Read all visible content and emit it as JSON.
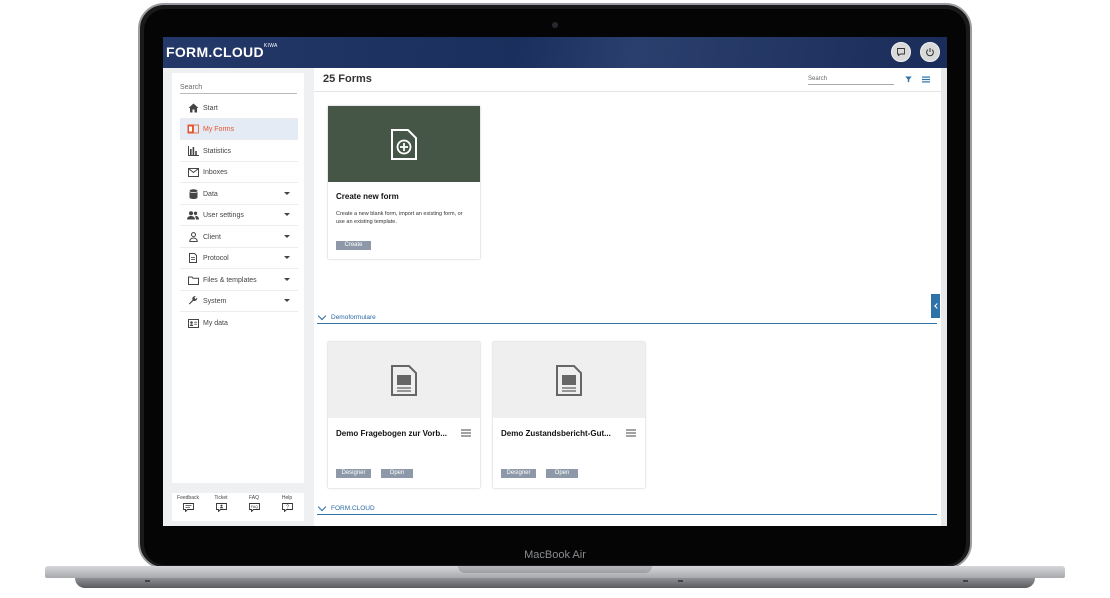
{
  "device": {
    "brand": "MacBook Air"
  },
  "app": {
    "logo": "FORM.CLOUD",
    "logo_sup": "KIWA"
  },
  "header": {
    "buttons": [
      {
        "icon": "chat-icon"
      },
      {
        "icon": "power-icon"
      }
    ]
  },
  "sidebar": {
    "search_placeholder": "Search",
    "items": [
      {
        "label": "Start",
        "icon": "home-icon"
      },
      {
        "label": "My Forms",
        "icon": "forms-icon",
        "active": true
      },
      {
        "label": "Statistics",
        "icon": "bar-chart-icon"
      },
      {
        "label": "Inboxes",
        "icon": "mail-icon"
      },
      {
        "label": "Data",
        "icon": "database-icon",
        "expandable": true
      },
      {
        "label": "User settings",
        "icon": "users-icon",
        "expandable": true
      },
      {
        "label": "Client",
        "icon": "person-icon",
        "expandable": true
      },
      {
        "label": "Protocol",
        "icon": "document-icon",
        "expandable": true
      },
      {
        "label": "Files & templates",
        "icon": "folder-icon",
        "expandable": true
      },
      {
        "label": "System",
        "icon": "wrench-icon",
        "expandable": true
      },
      {
        "label": "My data",
        "icon": "id-card-icon"
      }
    ]
  },
  "footer": {
    "items": [
      {
        "label": "Feedback",
        "icon": "feedback-icon"
      },
      {
        "label": "Ticket",
        "icon": "ticket-icon"
      },
      {
        "label": "FAQ",
        "icon": "faq-icon"
      },
      {
        "label": "Help",
        "icon": "help-icon"
      }
    ]
  },
  "content": {
    "title": "25 Forms",
    "search_placeholder": "Search",
    "create_card": {
      "title": "Create new form",
      "description": "Create a new blank form, import an existing form, or use an existing template.",
      "button": "Create",
      "image_color": "#465646"
    },
    "sections": [
      {
        "name": "Demoformulare",
        "cards": [
          {
            "title": "Demo Fragebogen zur Vorb...",
            "buttons": [
              "Designer",
              "Open"
            ]
          },
          {
            "title": "Demo Zustandsbericht-Gut...",
            "buttons": [
              "Designer",
              "Open"
            ]
          }
        ]
      },
      {
        "name": "FORM.CLOUD"
      }
    ]
  },
  "colors": {
    "header": "#1f335f",
    "accent": "#2f72a8",
    "active_text": "#e2562b",
    "button": "#8d99a8"
  }
}
